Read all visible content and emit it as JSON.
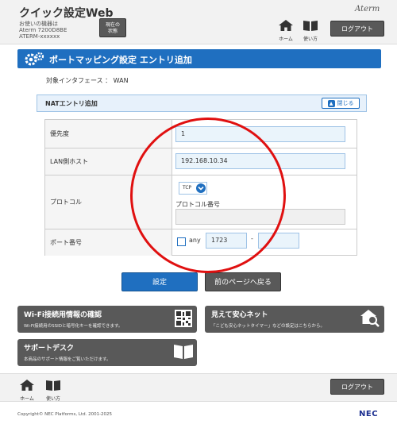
{
  "header": {
    "app_title": "クイック設定Web",
    "device_label": "お使いの機器は",
    "device_model": "Aterm 7200D8BE",
    "device_id": "ATERM-xxxxxx",
    "status_button_line1": "現在の",
    "status_button_line2": "状態",
    "home_label": "ホーム",
    "manual_label": "使い方",
    "brand_logo": "Aterm",
    "logout_label": "ログアウト"
  },
  "page": {
    "title": "ポートマッピング設定 エントリ追加",
    "interface_line": "対象インタフェース ： WAN"
  },
  "section": {
    "title": "NATエントリ追加",
    "close_label": "閉じる"
  },
  "form": {
    "priority": {
      "label": "優先度",
      "value": "1"
    },
    "lan_host": {
      "label": "LAN側ホスト",
      "value": "192.168.10.34"
    },
    "protocol": {
      "label": "プロトコル",
      "selected": "TCP",
      "number_label": "プロトコル番号",
      "number_value": ""
    },
    "port": {
      "label": "ポート番号",
      "any_label": "any",
      "any_checked": false,
      "from_value": "1723",
      "separator": "-",
      "to_value": ""
    }
  },
  "actions": {
    "submit_label": "設定",
    "back_label": "前のページへ戻る"
  },
  "cards": [
    {
      "title": "Wi-Fi接続用情報の確認",
      "subtitle": "Wi-Fi接続用のSSIDと暗号化キーを確認できます。",
      "icon": "qr-code-icon"
    },
    {
      "title": "見えて安心ネット",
      "subtitle": "「こども安心ネットタイマー」などの設定はこちらから。",
      "icon": "house-search-icon"
    },
    {
      "title": "サポートデスク",
      "subtitle": "本商品のサポート情報をご覧いただけます。",
      "icon": "book-icon"
    }
  ],
  "footer": {
    "home_label": "ホーム",
    "manual_label": "使い方",
    "logout_label": "ログアウト",
    "copyright": "Copyright© NEC Platforms, Ltd. 2001-2025",
    "brand": "NEC"
  },
  "colors": {
    "primary_blue": "#1f6fc0",
    "button_gray": "#595959",
    "annotation_red": "#e01010"
  }
}
